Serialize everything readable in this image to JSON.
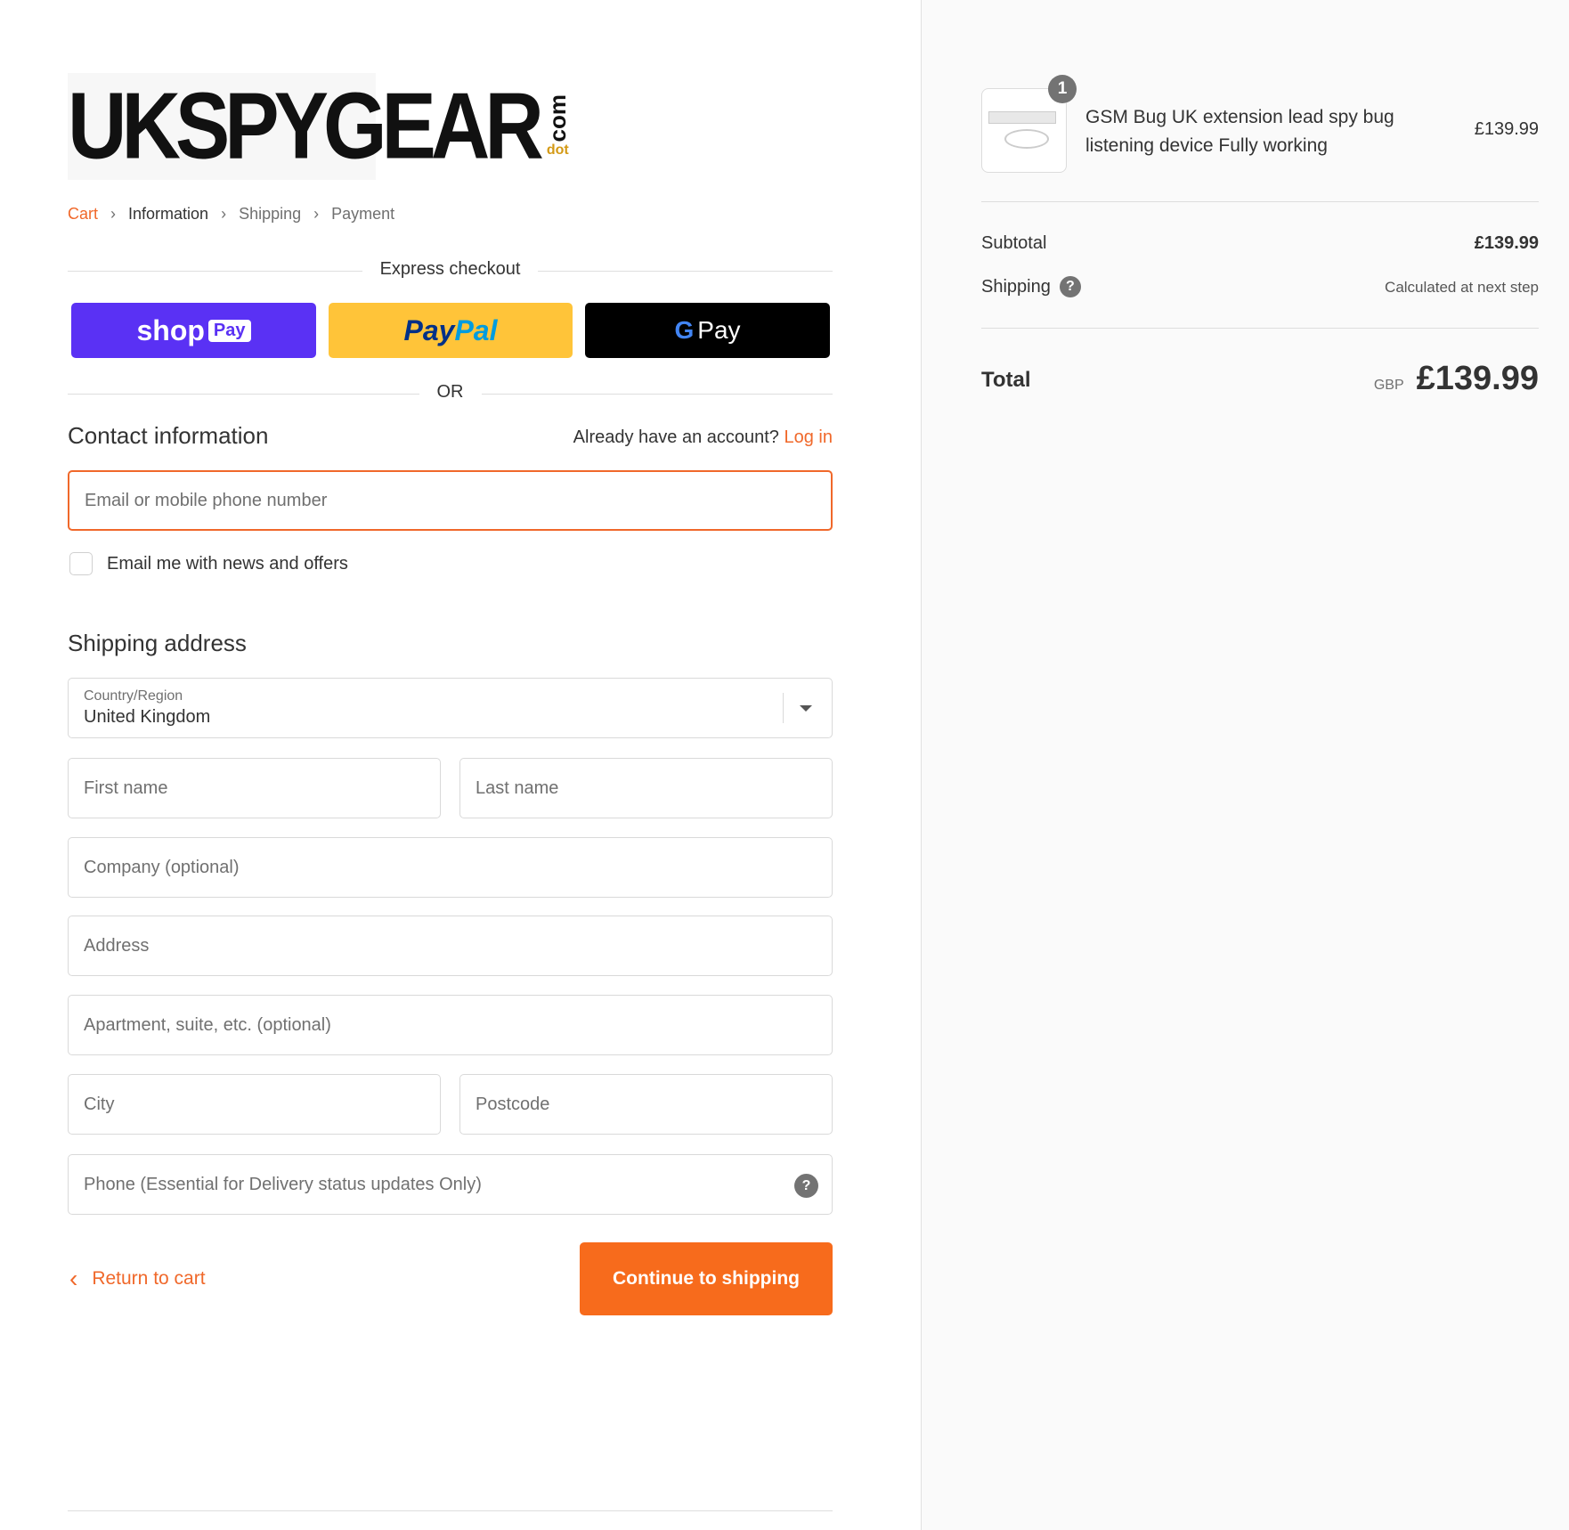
{
  "brand": {
    "logo_text": "UKSPYGEAR",
    "logo_suffix": "com",
    "logo_dot": "dot"
  },
  "breadcrumb": [
    "Cart",
    "Information",
    "Shipping",
    "Payment"
  ],
  "express": {
    "heading": "Express checkout",
    "shop_label": "shop",
    "shop_pay": "Pay",
    "paypal_a": "Pay",
    "paypal_b": "Pal",
    "gpay": "Pay",
    "or": "OR"
  },
  "contact": {
    "heading": "Contact information",
    "account_prompt": "Already have an account?",
    "login": "Log in",
    "email_placeholder": "Email or mobile phone number",
    "newsletter": "Email me with news and offers"
  },
  "shipping": {
    "heading": "Shipping address",
    "country_label": "Country/Region",
    "country_value": "United Kingdom",
    "first_name": "First name",
    "last_name": "Last name",
    "company": "Company (optional)",
    "address": "Address",
    "apartment": "Apartment, suite, etc. (optional)",
    "city": "City",
    "postcode": "Postcode",
    "phone": "Phone (Essential for Delivery status updates Only)"
  },
  "actions": {
    "return": "Return to cart",
    "continue": "Continue to shipping"
  },
  "summary": {
    "item": {
      "qty": "1",
      "title_line1": "GSM Bug UK extension lead spy bug",
      "title_line2": "listening device Fully working",
      "price": "£139.99"
    },
    "subtotal_label": "Subtotal",
    "subtotal": "£139.99",
    "shipping_label": "Shipping",
    "shipping_value": "Calculated at next step",
    "total_label": "Total",
    "currency": "GBP",
    "total": "£139.99"
  },
  "colors": {
    "accent": "#f76b1c",
    "shop_pay": "#5a31f4",
    "paypal": "#ffc439",
    "gpay": "#000000"
  }
}
